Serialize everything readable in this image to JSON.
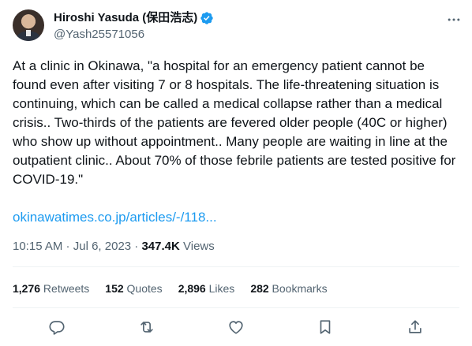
{
  "author": {
    "display_name": "Hiroshi Yasuda (保田浩志)",
    "handle": "@Yash25571056"
  },
  "tweet": {
    "text": "At a clinic in Okinawa, \"a hospital for an emergency patient cannot be found even after visiting 7 or 8 hospitals. The life-threatening situation is continuing, which can be called a medical collapse rather than a medical crisis.. Two-thirds of the patients are fevered older people (40C or higher) who show up without appointment.. Many people are waiting in line at the outpatient clinic.. About 70% of those febrile patients are tested positive for COVID-19.\"",
    "link_text": "okinawatimes.co.jp/articles/-/118..."
  },
  "meta": {
    "time": "10:15 AM",
    "separator1": " · ",
    "date": "Jul 6, 2023",
    "separator2": " · ",
    "views_count": "347.4K",
    "views_label": " Views"
  },
  "stats": [
    {
      "num": "1,276",
      "label": " Retweets"
    },
    {
      "num": "152",
      "label": " Quotes"
    },
    {
      "num": "2,896",
      "label": " Likes"
    },
    {
      "num": "282",
      "label": " Bookmarks"
    }
  ],
  "icons": {
    "verified": "verified-badge-icon",
    "more": "more-dots-icon",
    "reply": "reply-icon",
    "retweet": "retweet-icon",
    "like": "like-icon",
    "bookmark": "bookmark-icon",
    "share": "share-icon"
  },
  "colors": {
    "accent": "#1d9bf0",
    "text": "#0f1419",
    "muted": "#536471",
    "divider": "#eff3f4"
  }
}
